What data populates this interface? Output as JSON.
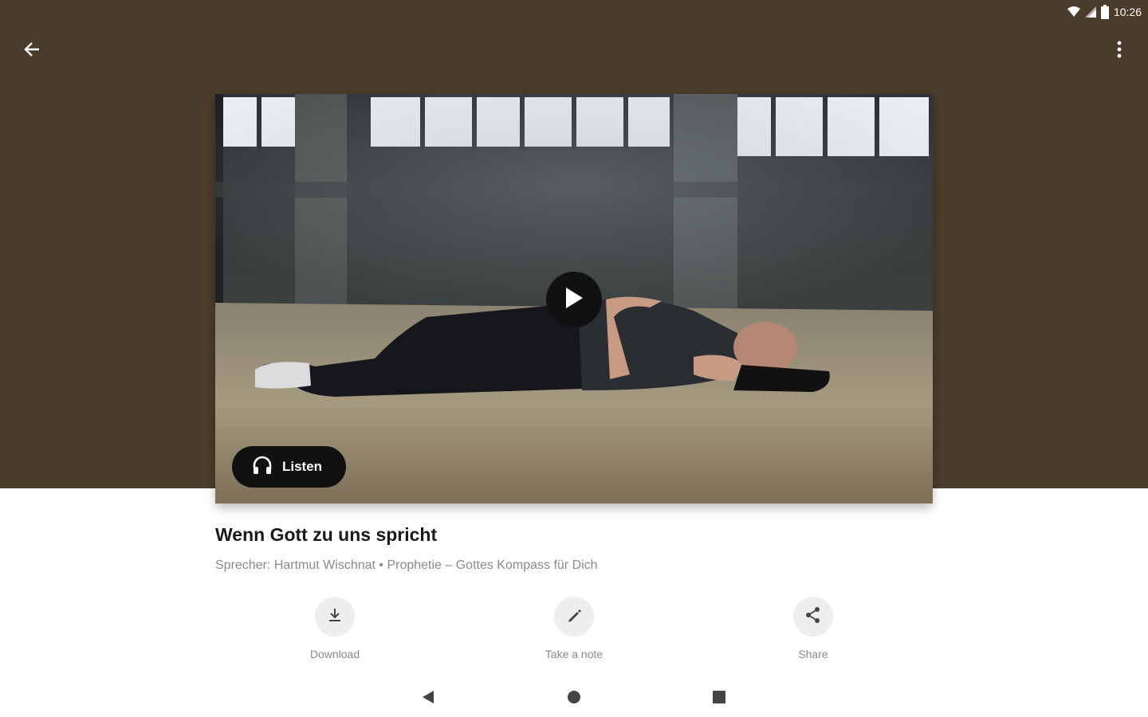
{
  "status_bar": {
    "time": "10:26"
  },
  "header": {
    "back_icon": "arrow-back-icon",
    "menu_icon": "more-vert-icon",
    "background_color": "#4a3c2b"
  },
  "video": {
    "play_icon": "play-icon",
    "listen_label": "Listen",
    "listen_icon": "headphones-icon"
  },
  "sermon": {
    "title": "Wenn Gott zu uns spricht",
    "subtitle": "Sprecher: Hartmut Wischnat • Prophetie – Gottes Kompass für Dich"
  },
  "actions": [
    {
      "label": "Download",
      "icon": "download-icon"
    },
    {
      "label": "Take a note",
      "icon": "pencil-icon"
    },
    {
      "label": "Share",
      "icon": "share-icon"
    }
  ],
  "navbar": {
    "back_icon": "nav-back-icon",
    "home_icon": "nav-home-icon",
    "recents_icon": "nav-recents-icon"
  }
}
